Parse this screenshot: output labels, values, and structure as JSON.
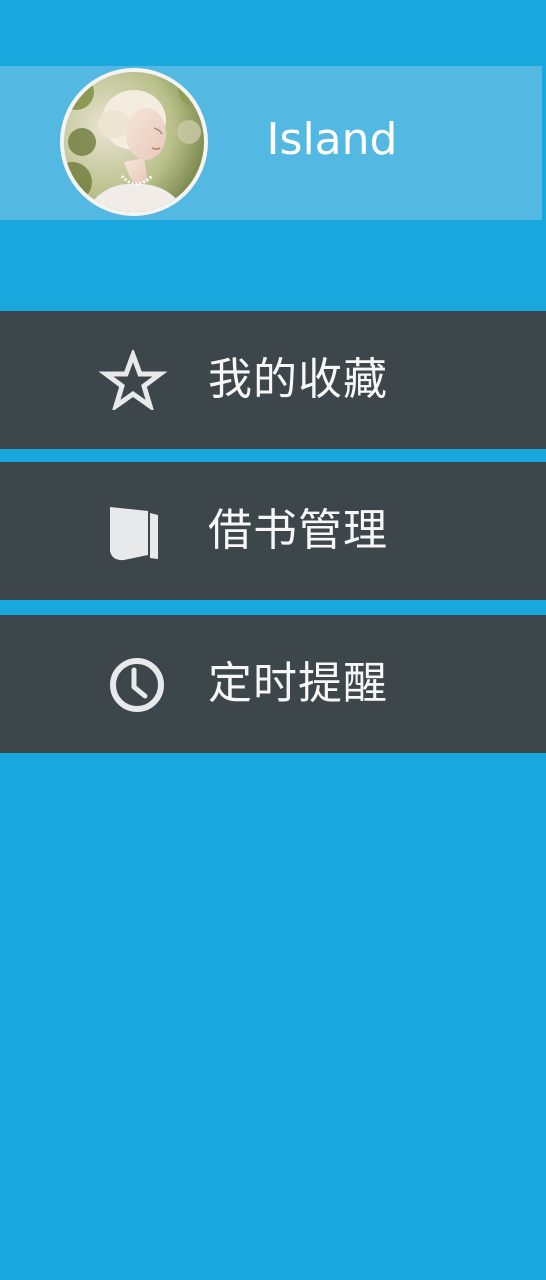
{
  "profile": {
    "username": "Island"
  },
  "menu": {
    "items": [
      {
        "label": "我的收藏",
        "icon": "star-outline-icon"
      },
      {
        "label": "借书管理",
        "icon": "book-icon"
      },
      {
        "label": "定时提醒",
        "icon": "clock-icon"
      }
    ]
  },
  "colors": {
    "background": "#19a8dd",
    "profile_band": "#53b9e2",
    "menu_item": "#3d464b",
    "icon": "#e7e9ea",
    "text": "#ffffff"
  }
}
